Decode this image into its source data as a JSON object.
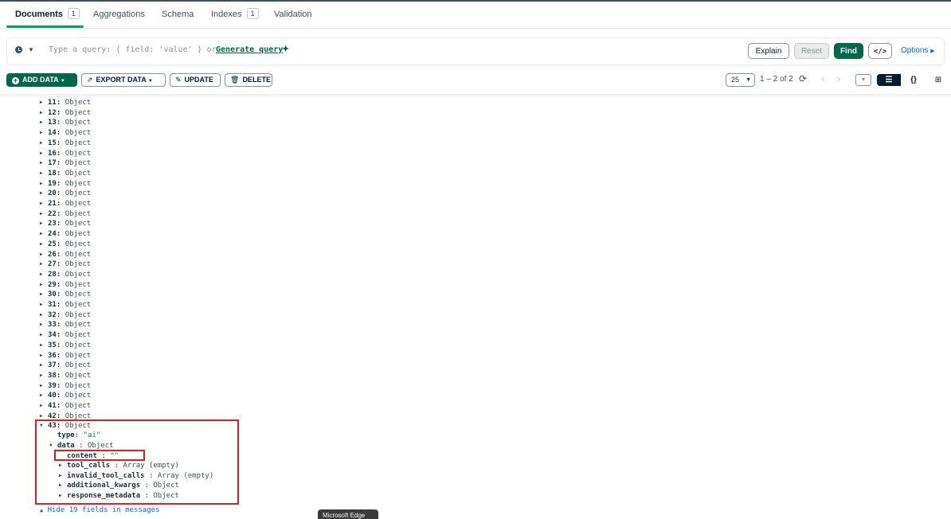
{
  "tabs": [
    {
      "label": "Documents",
      "count": "1"
    },
    {
      "label": "Aggregations"
    },
    {
      "label": "Schema"
    },
    {
      "label": "Indexes",
      "count": "1"
    },
    {
      "label": "Validation"
    }
  ],
  "query_bar": {
    "placeholder": "Type a query: { field: 'value' } or",
    "generate_link": "Generate query",
    "explain": "Explain",
    "reset": "Reset",
    "find": "Find",
    "code_toggle": "</>",
    "options": "Options"
  },
  "toolbar": {
    "add_data": "ADD DATA",
    "export_data": "EXPORT DATA",
    "update": "UPDATE",
    "delete": "DELETE",
    "page_size": "25",
    "range": "1 – 2 of 2"
  },
  "document": {
    "collapsed_items": [
      {
        "key": "11:",
        "type": "Object"
      },
      {
        "key": "12:",
        "type": "Object"
      },
      {
        "key": "13:",
        "type": "Object"
      },
      {
        "key": "14:",
        "type": "Object"
      },
      {
        "key": "15:",
        "type": "Object"
      },
      {
        "key": "16:",
        "type": "Object"
      },
      {
        "key": "17:",
        "type": "Object"
      },
      {
        "key": "18:",
        "type": "Object"
      },
      {
        "key": "19:",
        "type": "Object"
      },
      {
        "key": "20:",
        "type": "Object"
      },
      {
        "key": "21:",
        "type": "Object"
      },
      {
        "key": "22:",
        "type": "Object"
      },
      {
        "key": "23:",
        "type": "Object"
      },
      {
        "key": "24:",
        "type": "Object"
      },
      {
        "key": "25:",
        "type": "Object"
      },
      {
        "key": "26:",
        "type": "Object"
      },
      {
        "key": "27:",
        "type": "Object"
      },
      {
        "key": "28:",
        "type": "Object"
      },
      {
        "key": "29:",
        "type": "Object"
      },
      {
        "key": "30:",
        "type": "Object"
      },
      {
        "key": "31:",
        "type": "Object"
      },
      {
        "key": "32:",
        "type": "Object"
      },
      {
        "key": "33:",
        "type": "Object"
      },
      {
        "key": "34:",
        "type": "Object"
      },
      {
        "key": "35:",
        "type": "Object"
      },
      {
        "key": "36:",
        "type": "Object"
      },
      {
        "key": "37:",
        "type": "Object"
      },
      {
        "key": "38:",
        "type": "Object"
      },
      {
        "key": "39:",
        "type": "Object"
      },
      {
        "key": "40:",
        "type": "Object"
      },
      {
        "key": "41:",
        "type": "Object"
      },
      {
        "key": "42:",
        "type": "Object"
      }
    ],
    "expanded_item": {
      "key": "43:",
      "type": "Object",
      "type_field": {
        "key": "type",
        "value": "\"ai\""
      },
      "data_field": {
        "key": "data",
        "type": "Object"
      },
      "data_children": [
        {
          "key": "content",
          "value": "\"\""
        },
        {
          "key": "tool_calls",
          "type": "Array (empty)"
        },
        {
          "key": "invalid_tool_calls",
          "type": "Array (empty)"
        },
        {
          "key": "additional_kwargs",
          "type": "Object"
        },
        {
          "key": "response_metadata",
          "type": "Object"
        }
      ]
    },
    "hide_fields": "Hide 19 fields in messages"
  },
  "tooltip": "Microsoft Edge",
  "colors": {
    "accent": "#00684a",
    "highlight": "#db1f1f",
    "link": "#016bf8"
  }
}
